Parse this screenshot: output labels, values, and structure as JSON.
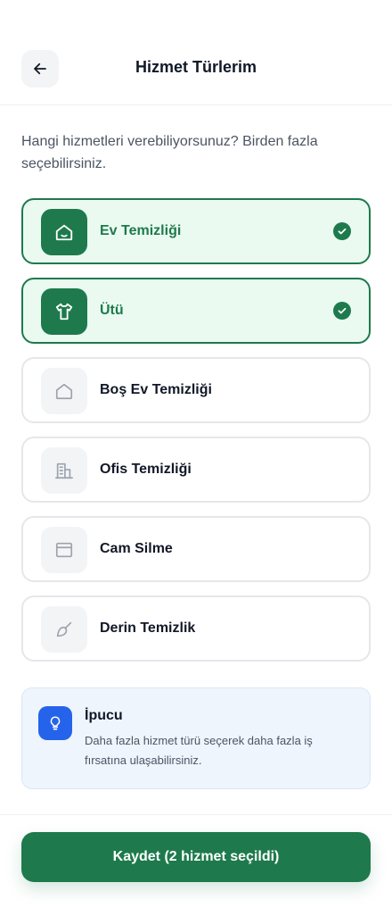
{
  "header": {
    "title": "Hizmet Türlerim",
    "back_icon": "arrow-left-icon"
  },
  "question": "Hangi hizmetleri verebiliyorsunuz? Birden fazla seçebilirsiniz.",
  "services": [
    {
      "label": "Ev Temizliği",
      "icon": "home-icon",
      "selected": true
    },
    {
      "label": "Ütü",
      "icon": "shirt-icon",
      "selected": true
    },
    {
      "label": "Boş Ev Temizliği",
      "icon": "empty-home-icon",
      "selected": false
    },
    {
      "label": "Ofis Temizliği",
      "icon": "office-building-icon",
      "selected": false
    },
    {
      "label": "Cam Silme",
      "icon": "window-icon",
      "selected": false
    },
    {
      "label": "Derin Temizlik",
      "icon": "brush-icon",
      "selected": false
    }
  ],
  "tip": {
    "title": "İpucu",
    "body": "Daha fazla hizmet türü seçerek daha fazla iş fırsatına ulaşabilirsiniz.",
    "icon": "lightbulb-icon"
  },
  "save_button": {
    "label": "Kaydet (2 hizmet seçildi)"
  },
  "colors": {
    "accent": "#1e7a4c",
    "selected_bg": "#eafaf1",
    "tip_bg": "#eef5fd",
    "tip_icon_bg": "#2563eb"
  }
}
